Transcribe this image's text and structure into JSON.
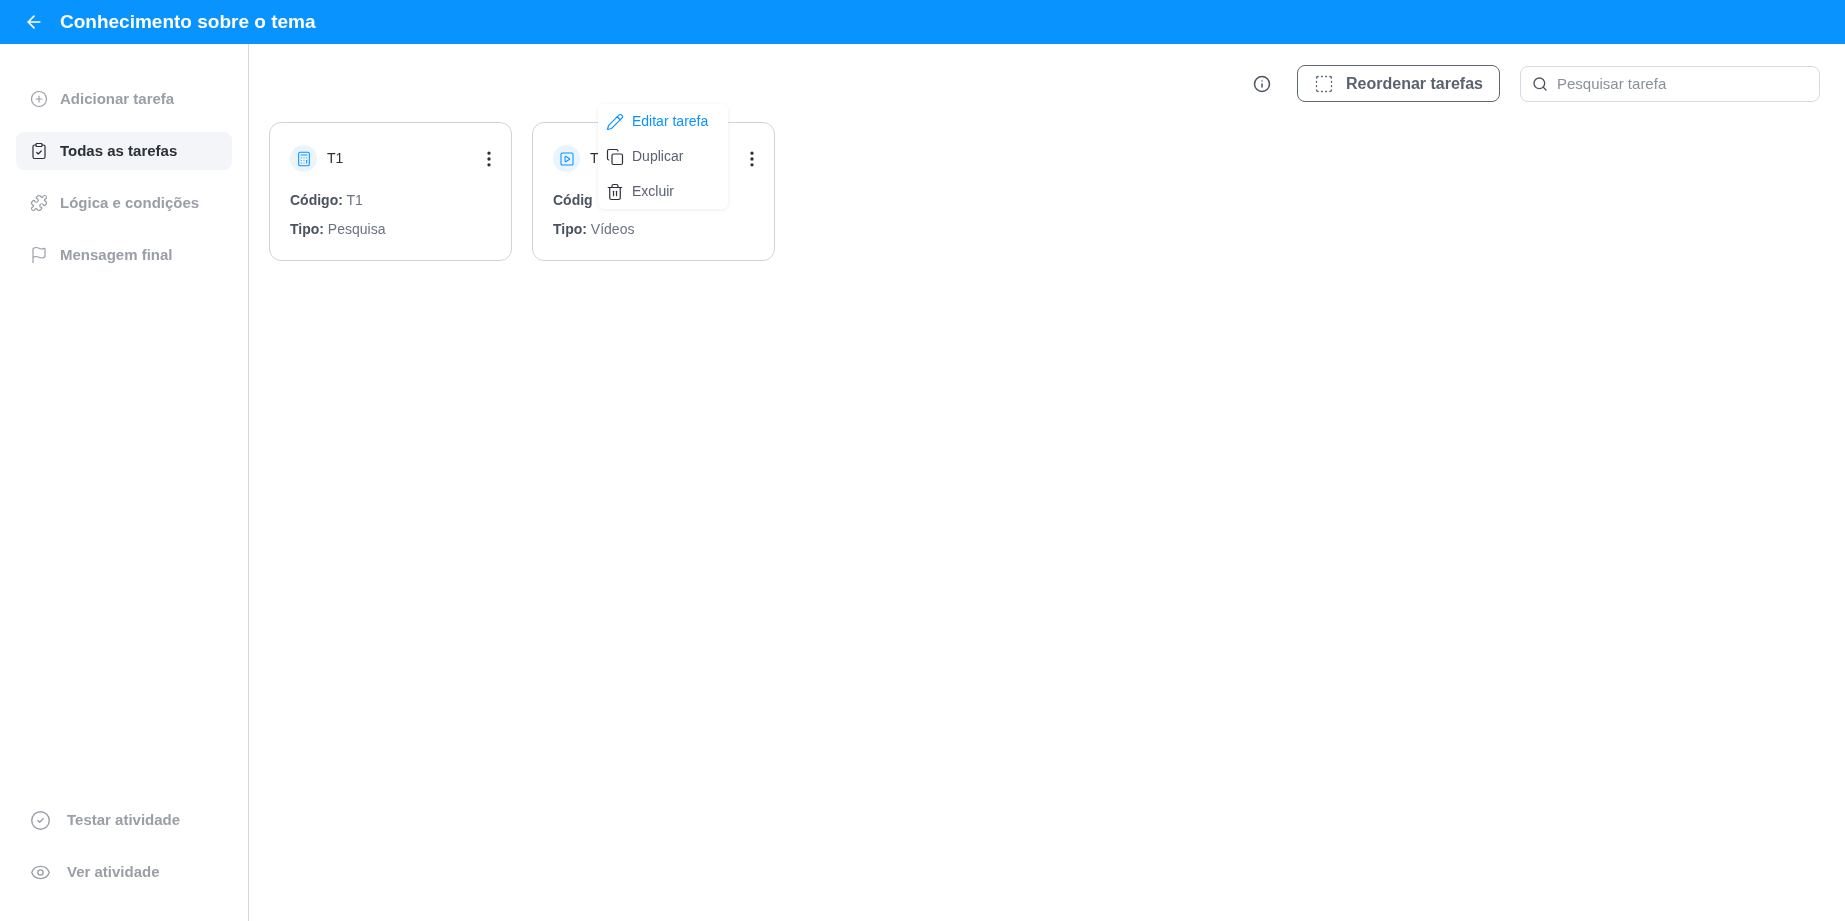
{
  "header": {
    "title": "Conhecimento sobre o tema"
  },
  "sidebar": {
    "items": [
      {
        "label": "Adicionar tarefa",
        "selected": false
      },
      {
        "label": "Todas as tarefas",
        "selected": true
      },
      {
        "label": "Lógica e condições",
        "selected": false
      },
      {
        "label": "Mensagem final",
        "selected": false
      }
    ],
    "bottom_items": [
      {
        "label": "Testar atividade"
      },
      {
        "label": "Ver atividade"
      }
    ]
  },
  "toolbar": {
    "reorder_button": "Reordenar tarefas",
    "search": {
      "placeholder": "Pesquisar tarefa"
    }
  },
  "context_menu": {
    "items": [
      {
        "label": "Editar tarefa",
        "selected": true
      },
      {
        "label": "Duplicar",
        "selected": false
      },
      {
        "label": "Excluir",
        "selected": false
      }
    ]
  },
  "cards": [
    {
      "title": "T1",
      "code_label": "Código:",
      "code_value": "T1",
      "type_label": "Tipo:",
      "type_value": "Pesquisa"
    },
    {
      "title": "T",
      "code_label": "Códig",
      "type_label": "Tipo:",
      "type_value": "Vídeos"
    }
  ]
}
